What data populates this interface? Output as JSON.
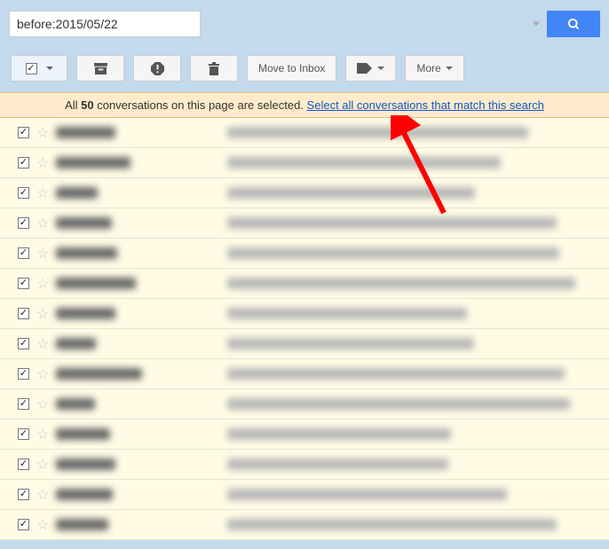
{
  "search": {
    "value": "before:2015/05/22"
  },
  "toolbar": {
    "move_label": "Move to Inbox",
    "more_label": "More"
  },
  "banner": {
    "prefix": "All ",
    "count": "50",
    "mid": " conversations on this page are selected. ",
    "link": "Select all conversations that match this search"
  },
  "rows": [
    {
      "s": 50,
      "t": 60
    },
    {
      "s": 45,
      "t": 55
    },
    {
      "s": 40,
      "t": 70
    },
    {
      "s": 60,
      "t": 65
    },
    {
      "s": 55,
      "t": 45
    },
    {
      "s": 25,
      "t": 75
    },
    {
      "s": 25,
      "t": 80
    },
    {
      "s": 45,
      "t": 60
    },
    {
      "s": 50,
      "t": 40
    },
    {
      "s": 60,
      "t": 55
    },
    {
      "s": 85,
      "t": 65
    },
    {
      "s": 40,
      "t": 50
    },
    {
      "s": 55,
      "t": 45
    },
    {
      "s": 45,
      "t": 55
    }
  ]
}
